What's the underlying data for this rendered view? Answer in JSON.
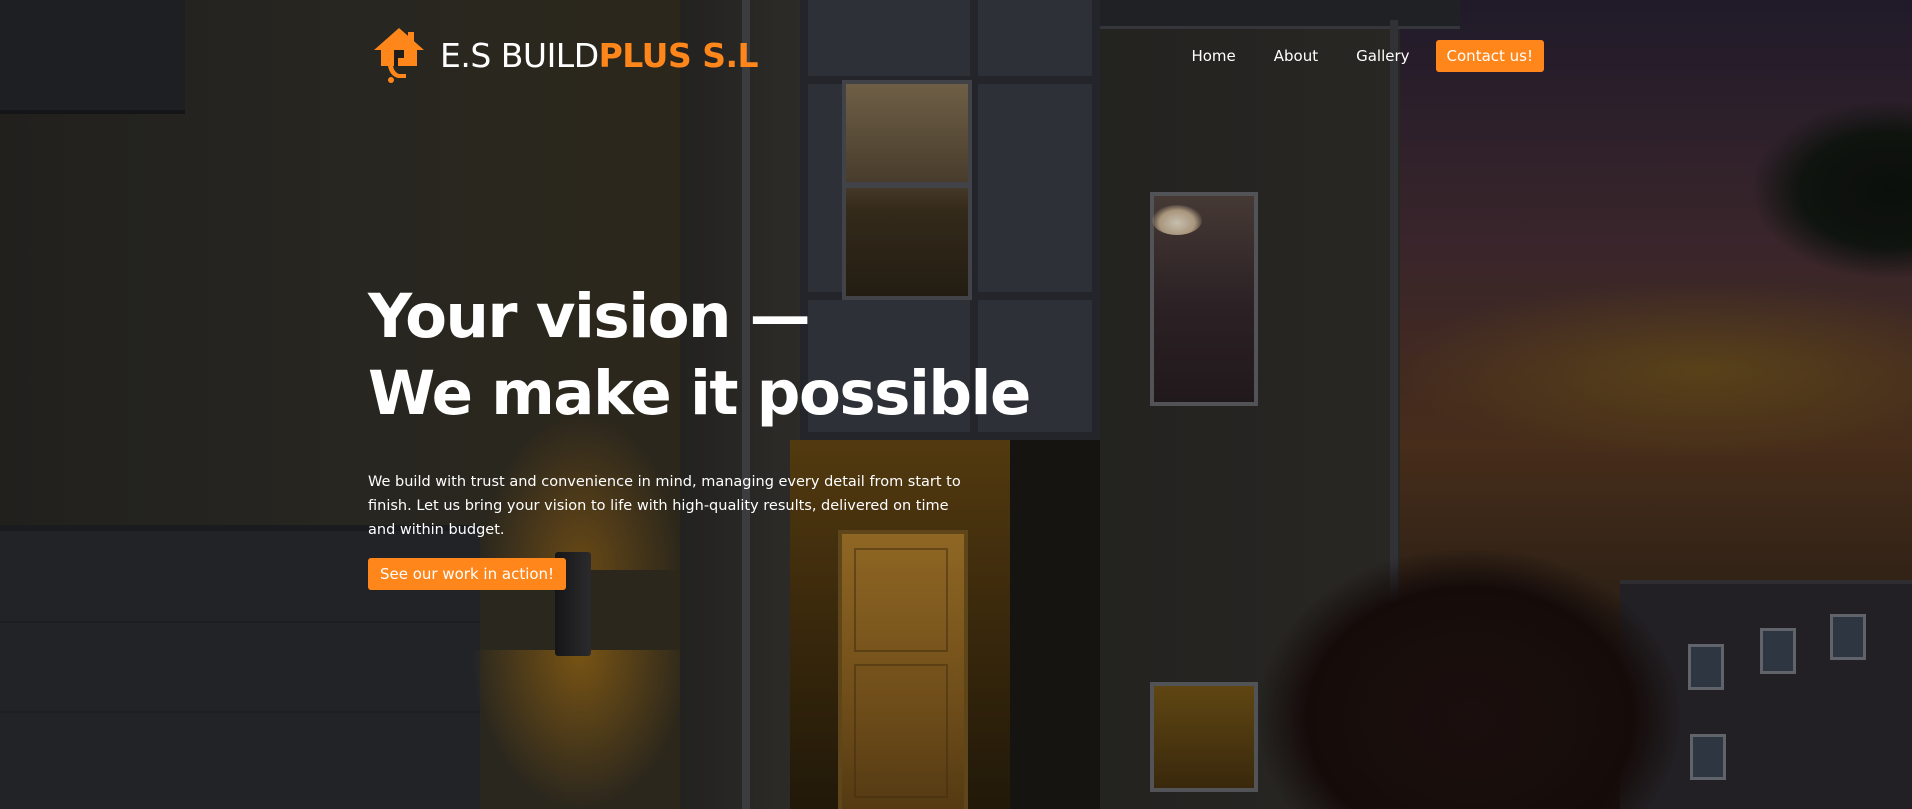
{
  "brand": {
    "logo_icon": "house-hand-icon",
    "name_prefix": "E.S BUILD",
    "name_accent": "PLUS S.L",
    "accent_color": "#ff861a"
  },
  "nav": {
    "items": [
      {
        "label": "Home"
      },
      {
        "label": "About"
      },
      {
        "label": "Gallery"
      }
    ],
    "cta_label": "Contact us!"
  },
  "hero": {
    "headline_line1": "Your vision —",
    "headline_line2": "We make it possible",
    "description": "We build with trust and convenience in mind, managing every detail from start to finish. Let us bring your vision to life with high-quality results, delivered on time and within budget.",
    "cta_label": "See our work in action!"
  }
}
